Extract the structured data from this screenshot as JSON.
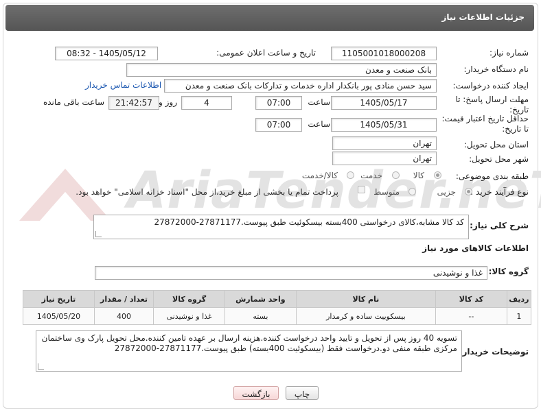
{
  "header": {
    "title": "جزئیات اطلاعات نیاز"
  },
  "watermark": {
    "brand": "AriaTender.neT"
  },
  "fields": {
    "need_number_label": "شماره نیاز:",
    "need_number": "1105001018000208",
    "announce_label": "تاریخ و ساعت اعلان عمومی:",
    "announce_value": "1405/05/12 - 08:32",
    "buyer_label": "نام دستگاه خریدار:",
    "buyer_value": "بانک صنعت و معدن",
    "creator_label": "ایجاد کننده درخواست:",
    "creator_value": "سید حسن منادی پور بانکدار اداره خدمات و تدارکات بانک صنعت و معدن",
    "contact_link": "اطلاعات تماس خریدار",
    "deadline_label_1": "مهلت ارسال پاسخ: تا",
    "deadline_label_2": "تاریخ:",
    "deadline_date": "1405/05/17",
    "time_label": "ساعت",
    "deadline_time": "07:00",
    "days_value": "4",
    "days_label": "روز و",
    "remaining_time": "21:42:57",
    "remaining_label": "ساعت باقی مانده",
    "validity_label_1": "حداقل تاریخ اعتبار قیمت:",
    "validity_label_2": "تا تاریخ:",
    "validity_date": "1405/05/31",
    "validity_time": "07:00",
    "province_label": "استان محل تحویل:",
    "province_value": "تهران",
    "city_label": "شهر محل تحویل:",
    "city_value": "تهران",
    "category_label": "طبقه بندی موضوعی:",
    "category_options": [
      "کالا",
      "خدمت",
      "کالا/خدمت"
    ],
    "process_label": "نوع فرآیند خرید :",
    "process_options": [
      "جزیی",
      "متوسط"
    ],
    "process_note": "پرداخت تمام یا بخشی از مبلغ خرید،از محل \"اسناد خزانه اسلامی\" خواهد بود."
  },
  "description": {
    "label": "شرح کلی نیاز:",
    "value": "کد کالا مشابه،کالای درخواستی 400بسته بیسکوئیت طبق پیوست.27871177-27872000"
  },
  "goods_info": {
    "title": "اطلاعات کالاهای مورد نیاز",
    "group_label": "گروه کالا:",
    "group_value": "غذا و نوشیدنی"
  },
  "table": {
    "headers": [
      "ردیف",
      "کد کالا",
      "نام کالا",
      "واحد شمارش",
      "گروه کالا",
      "تعداد / مقدار",
      "تاریخ نیاز"
    ],
    "rows": [
      [
        "1",
        "--",
        "بیسکوییت ساده و کرمدار",
        "بسته",
        "غذا و نوشیدنی",
        "400",
        "1405/05/20"
      ]
    ]
  },
  "buyer_notes": {
    "label": "توضیحات خریدار:",
    "line1": "تسویه 40 روز پس از تحویل و تایید واحد درخواست کننده.هزینه ارسال بر عهده تامین کننده.محل تحویل پارک وی ساختمان",
    "line2": "مرکزی طبقه منفی دو.درخواست فقط (بیسکوئیت 400بسته) طبق پیوست.27871177-27872000"
  },
  "buttons": {
    "print": "چاپ",
    "back": "بازگشت"
  },
  "colors": {
    "header_bg": "#5f5f5f",
    "link": "#1a56b0",
    "back_button": "#f7d7d7"
  }
}
